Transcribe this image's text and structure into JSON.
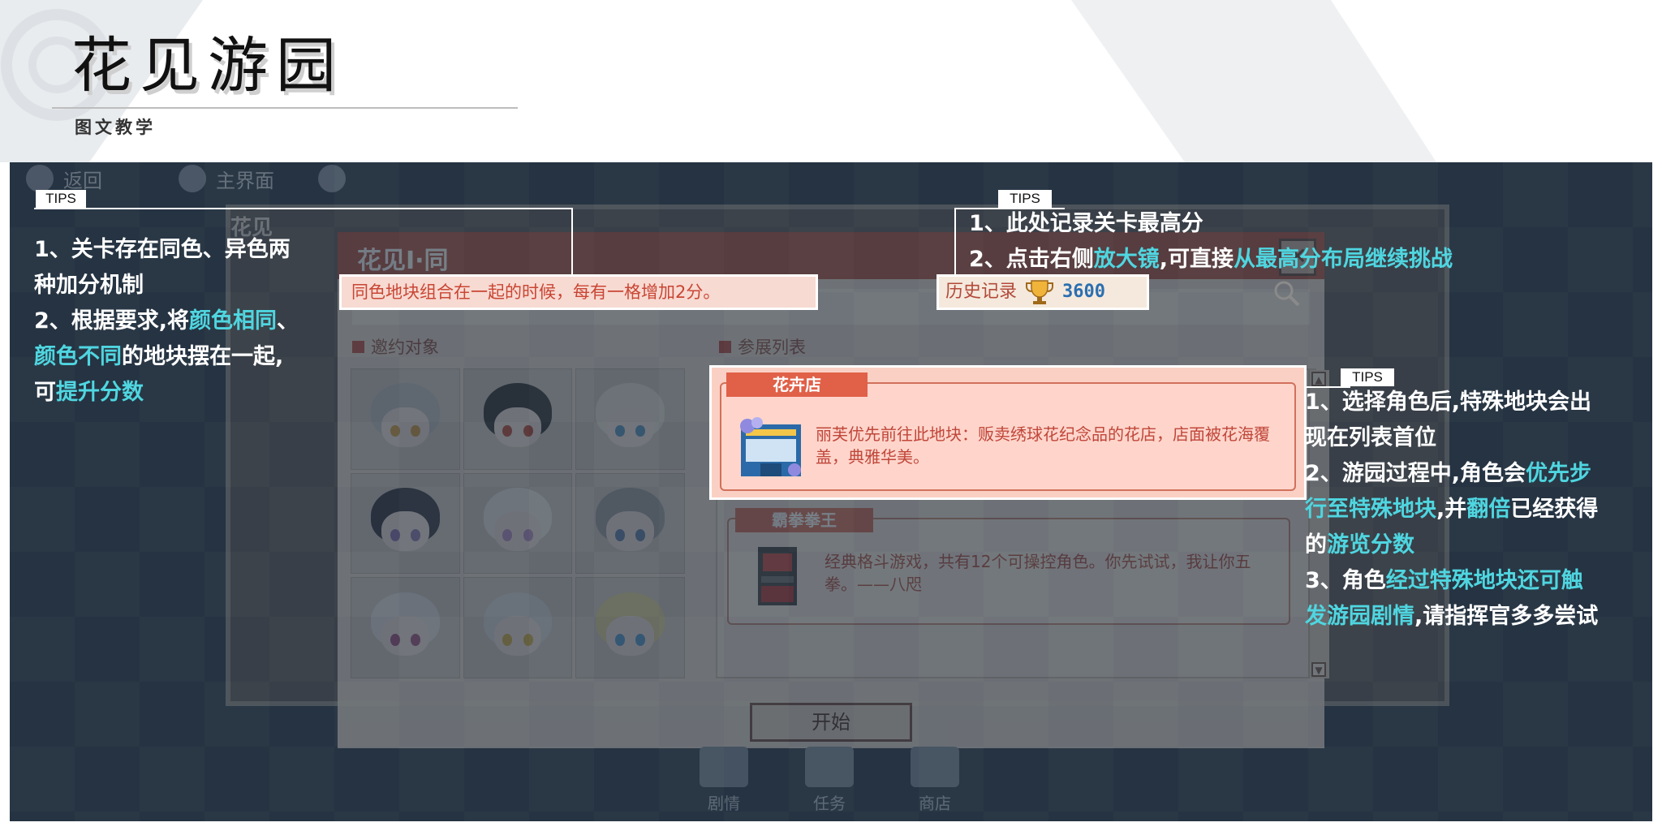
{
  "page": {
    "title": "花见游园",
    "subtitle": "图文教学"
  },
  "game": {
    "nav": {
      "back_label": "返回",
      "home_label": "主界面"
    },
    "window_title": "花见",
    "dialog": {
      "title": "花见Ⅰ·同",
      "close_label": "✕",
      "section_invite": "邀约对象",
      "section_list": "参展列表",
      "hint": "同色地块组合在一起的时候，每有一格增加2分。",
      "record_label": "历史记录",
      "record_score": "3600",
      "cards": [
        {
          "tag": "花卉店",
          "desc": "丽芙优先前往此地块：贩卖绣球花纪念品的花店，店面被花海覆盖，典雅华美。"
        },
        {
          "tag": "霸拳拳王",
          "desc": "经典格斗游戏，共有12个可操控角色。你先试试，我让你五拳。——八咫"
        }
      ],
      "start_label": "开始"
    },
    "bottom_nav": [
      "剧情",
      "任务",
      "商店"
    ]
  },
  "tips": [
    {
      "label": "TIPS",
      "lines": [
        [
          {
            "t": "1、关卡存在同色、异色两"
          }
        ],
        [
          {
            "t": "种加分机制"
          }
        ],
        [
          {
            "t": "2、根据要求,将"
          },
          {
            "t": "颜色相同",
            "hl": true
          },
          {
            "t": "、"
          }
        ],
        [
          {
            "t": "颜色不同",
            "hl": true
          },
          {
            "t": "的地块摆在一起,"
          }
        ],
        [
          {
            "t": "可"
          },
          {
            "t": "提升分数",
            "hl": true
          }
        ]
      ]
    },
    {
      "label": "TIPS",
      "lines": [
        [
          {
            "t": "1、此处记录关卡最高分"
          }
        ],
        [
          {
            "t": "2、点击右侧"
          },
          {
            "t": "放大镜",
            "hl": true
          },
          {
            "t": ",可直接"
          },
          {
            "t": "从最高分布局继续挑战",
            "hl": true
          }
        ]
      ]
    },
    {
      "label": "TIPS",
      "lines": [
        [
          {
            "t": "1、选择角色后,特殊地块会出"
          }
        ],
        [
          {
            "t": "现在列表首位"
          }
        ],
        [
          {
            "t": "2、游园过程中,角色会"
          },
          {
            "t": "优先步",
            "hl": true
          }
        ],
        [
          {
            "t": "行至特殊地块",
            "hl": true
          },
          {
            "t": ",并"
          },
          {
            "t": "翻倍",
            "hl": true
          },
          {
            "t": "已经获得"
          }
        ],
        [
          {
            "t": "的"
          },
          {
            "t": "游览分数",
            "hl": true
          }
        ],
        [
          {
            "t": "3、角色"
          },
          {
            "t": "经过特殊地块还可触",
            "hl": true
          }
        ],
        [
          {
            "t": "发游园剧情",
            "hl": true
          },
          {
            "t": ",请指挥官多多尝试"
          }
        ]
      ]
    }
  ],
  "colors": {
    "highlight": "#4fd6e0",
    "panel_bg": "#253342",
    "accent_red": "#c94634"
  }
}
